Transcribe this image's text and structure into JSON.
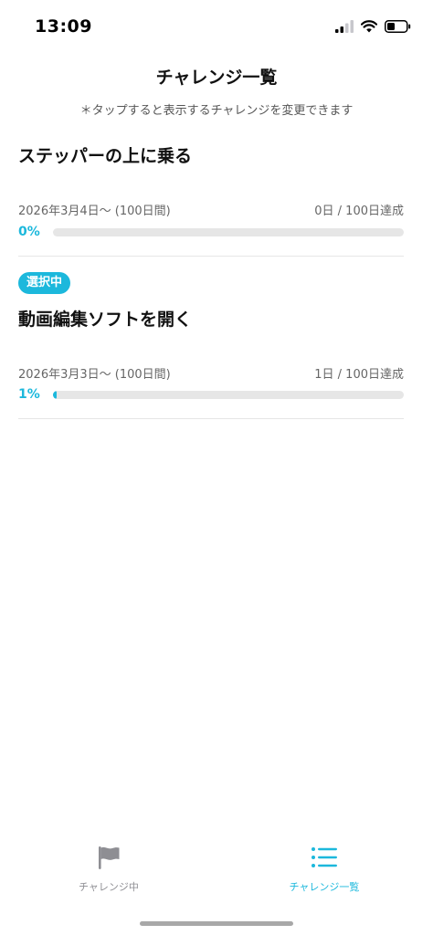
{
  "status": {
    "time": "13:09"
  },
  "header": {
    "title": "チャレンジ一覧",
    "subtitle": "＊タップすると表示するチャレンジを変更できます"
  },
  "challenges": [
    {
      "title": "ステッパーの上に乗る",
      "period": "2026年3月4日〜 (100日間)",
      "achieved": "0日 / 100日達成",
      "percent_label": "0%",
      "progress": 0,
      "selected": false
    },
    {
      "badge": "選択中",
      "title": "動画編集ソフトを開く",
      "period": "2026年3月3日〜 (100日間)",
      "achieved": "1日 / 100日達成",
      "percent_label": "1%",
      "progress": 0.01,
      "selected": true
    }
  ],
  "tabbar": {
    "tabs": [
      {
        "label": "チャレンジ中",
        "icon": "flag-icon",
        "active": false
      },
      {
        "label": "チャレンジ一覧",
        "icon": "list-icon",
        "active": true
      }
    ]
  },
  "colors": {
    "accent": "#1cb8dc",
    "inactive": "#8e8e93",
    "track": "#e6e6e6"
  }
}
